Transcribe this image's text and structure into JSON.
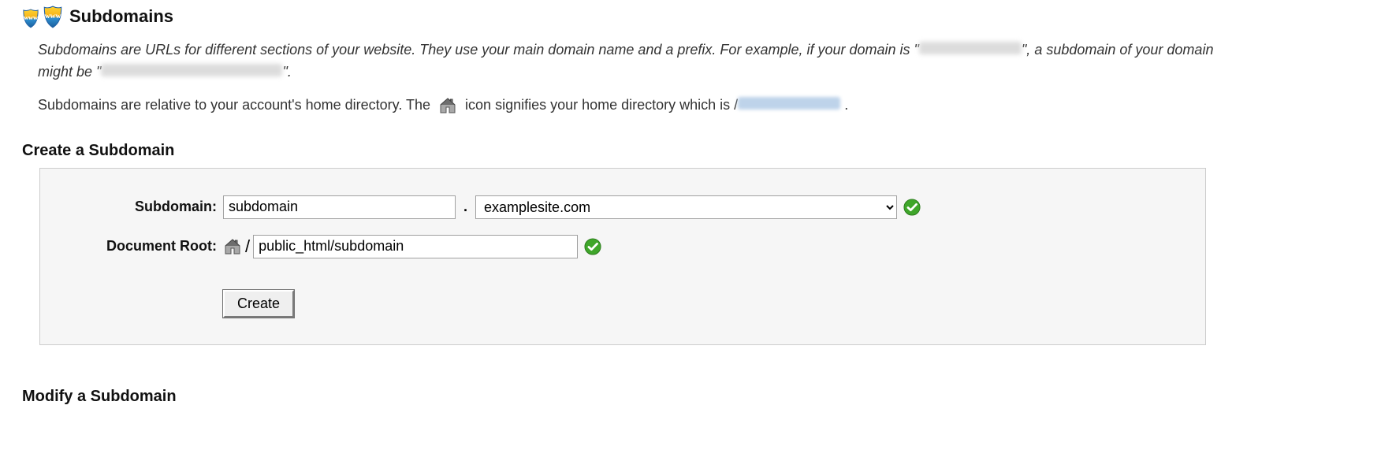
{
  "header": {
    "title": "Subdomains"
  },
  "desc": {
    "line1a": "Subdomains are URLs for different sections of your website. They use your main domain name and a prefix. For example, if your domain is \"",
    "line1b": "\", a subdomain of your domain might be \"",
    "line1c": "\".",
    "line2a": "Subdomains are relative to your account's home directory. The ",
    "line2b": " icon signifies your home directory which is /",
    "line2c": " ."
  },
  "sections": {
    "create_heading": "Create a Subdomain",
    "modify_heading": "Modify a Subdomain"
  },
  "form": {
    "subdomain_label": "Subdomain:",
    "docroot_label": "Document Root:",
    "subdomain_value": "subdomain",
    "domain_selected": "examplesite.com",
    "docroot_value": "public_html/subdomain",
    "create_label": "Create",
    "slash": "/",
    "dot": "."
  }
}
